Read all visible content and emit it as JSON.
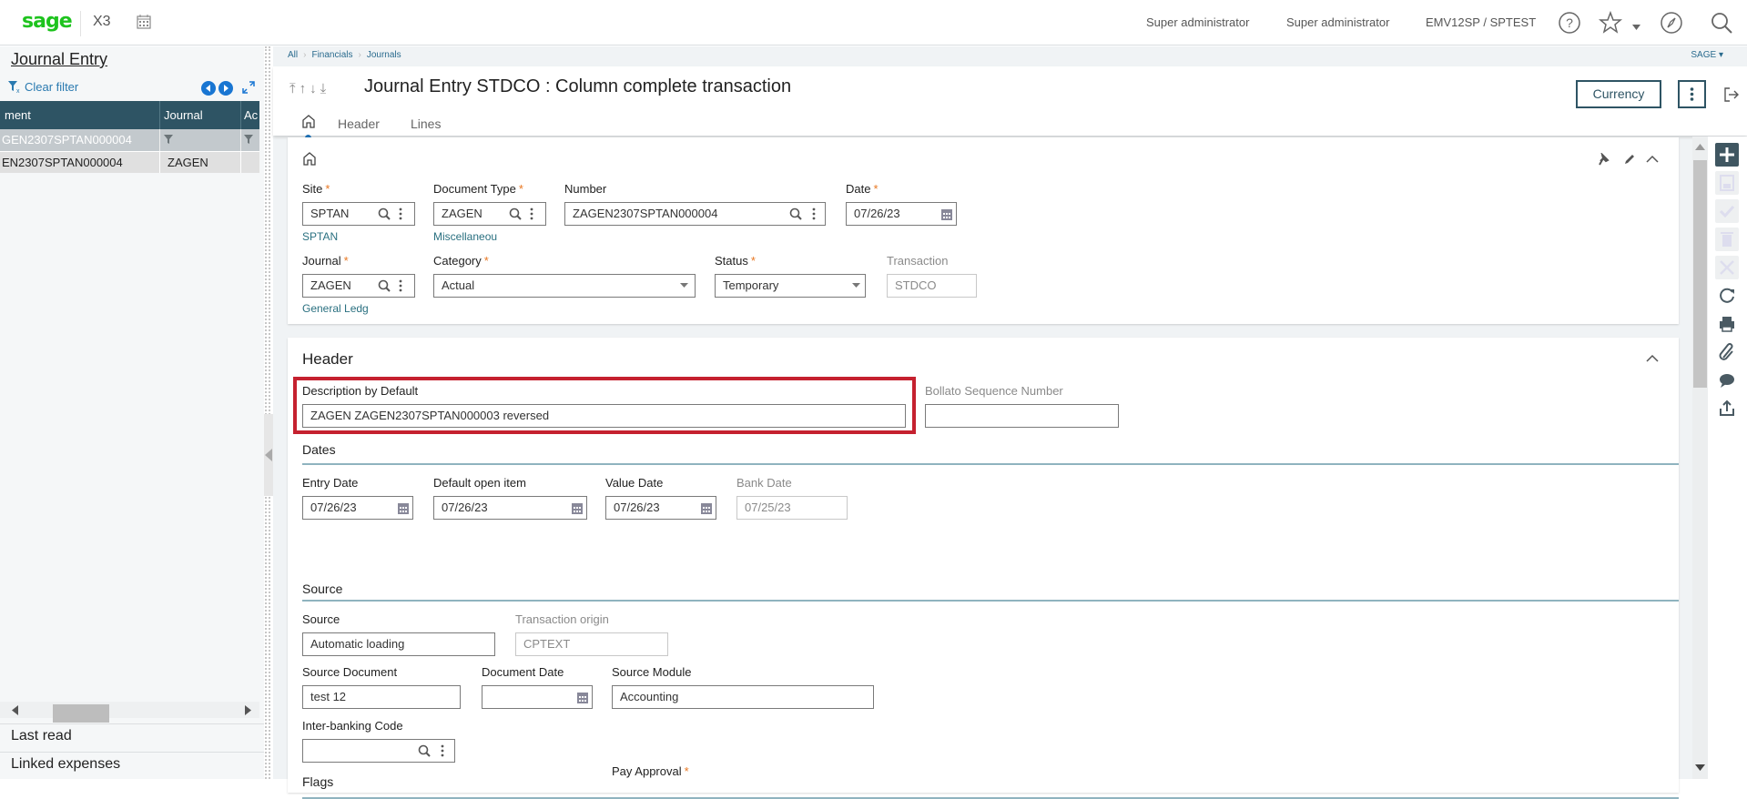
{
  "app": {
    "brand": "sage",
    "product": "X3",
    "user_name": "Super administrator",
    "user_role": "Super administrator",
    "folder": "EMV12SP / SPTEST",
    "colors": {
      "brand_green": "#1ec31e",
      "grid_header": "#2e5464",
      "accent_blue": "#1976d2",
      "required": "#e87722",
      "highlight_red": "#c5212f"
    }
  },
  "left_panel": {
    "title": "Journal Entry",
    "clear_filter": "Clear filter",
    "grid": {
      "columns": [
        "ment",
        "Journal",
        "Ac"
      ],
      "filter_row": [
        "GEN2307SPTAN000004",
        "",
        ""
      ],
      "rows": [
        [
          "EN2307SPTAN000004",
          "ZAGEN",
          ""
        ]
      ]
    },
    "links": [
      "Last read",
      "Linked expenses"
    ]
  },
  "breadcrumb": [
    "All",
    "Financials",
    "Journals"
  ],
  "endpoint_menu": "SAGE",
  "page": {
    "title": "Journal Entry STDCO : Column complete transaction",
    "tabs": [
      "Header",
      "Lines"
    ],
    "currency_button": "Currency"
  },
  "top_section": {
    "site": {
      "label": "Site",
      "value": "SPTAN",
      "sub": "SPTAN"
    },
    "document_type": {
      "label": "Document Type",
      "value": "ZAGEN",
      "sub": "Miscellaneou"
    },
    "number": {
      "label": "Number",
      "value": "ZAGEN2307SPTAN000004"
    },
    "date": {
      "label": "Date",
      "value": "07/26/23"
    },
    "journal": {
      "label": "Journal",
      "value": "ZAGEN",
      "sub": "General Ledg"
    },
    "category": {
      "label": "Category",
      "value": "Actual"
    },
    "status": {
      "label": "Status",
      "value": "Temporary"
    },
    "transaction": {
      "label": "Transaction",
      "value": "STDCO"
    }
  },
  "header_section": {
    "title": "Header",
    "description": {
      "label": "Description by Default",
      "value": "ZAGEN ZAGEN2307SPTAN000003 reversed"
    },
    "bollato": {
      "label": "Bollato Sequence Number",
      "value": ""
    },
    "dates_title": "Dates",
    "entry_date": {
      "label": "Entry Date",
      "value": "07/26/23"
    },
    "default_open_item": {
      "label": "Default open item",
      "value": "07/26/23"
    },
    "value_date": {
      "label": "Value Date",
      "value": "07/26/23"
    },
    "bank_date": {
      "label": "Bank Date",
      "value": "07/25/23"
    },
    "source_title": "Source",
    "source": {
      "label": "Source",
      "value": "Automatic loading"
    },
    "transaction_origin": {
      "label": "Transaction origin",
      "value": "CPTEXT"
    },
    "source_document": {
      "label": "Source Document",
      "value": "test 12"
    },
    "document_date": {
      "label": "Document Date",
      "value": ""
    },
    "source_module": {
      "label": "Source Module",
      "value": "Accounting"
    },
    "inter_banking": {
      "label": "Inter-banking Code",
      "value": ""
    },
    "flags_title": "Flags",
    "pay_approval": {
      "label": "Pay Approval"
    }
  }
}
